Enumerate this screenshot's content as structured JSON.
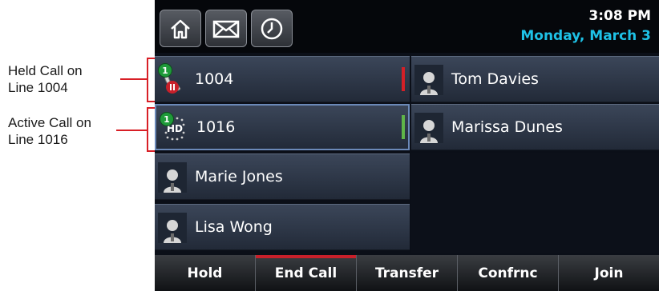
{
  "annotations": {
    "held": {
      "line1": "Held Call on",
      "line2": "Line 1004"
    },
    "active": {
      "line1": "Active Call on",
      "line2": "Line 1016"
    }
  },
  "status": {
    "time": "3:08 PM",
    "date": "Monday, March 3"
  },
  "top_buttons": [
    {
      "name": "home",
      "icon": "home-icon"
    },
    {
      "name": "messages",
      "icon": "envelope-icon"
    },
    {
      "name": "recent-calls",
      "icon": "clock-icon"
    }
  ],
  "lines": [
    {
      "label": "1004",
      "state": "held",
      "badge": "1",
      "indicator_color": "#d42027"
    },
    {
      "label": "1016",
      "state": "active",
      "badge": "1",
      "indicator_color": "#5fb548"
    }
  ],
  "left_contacts": [
    "Marie Jones",
    "Lisa Wong"
  ],
  "right_contacts": [
    "Tom Davies",
    "Marissa Dunes"
  ],
  "softkeys": [
    "Hold",
    "End Call",
    "Transfer",
    "Confrnc",
    "Join"
  ],
  "colors": {
    "accent": "#1ec1e6",
    "annotation": "#d81f26"
  }
}
